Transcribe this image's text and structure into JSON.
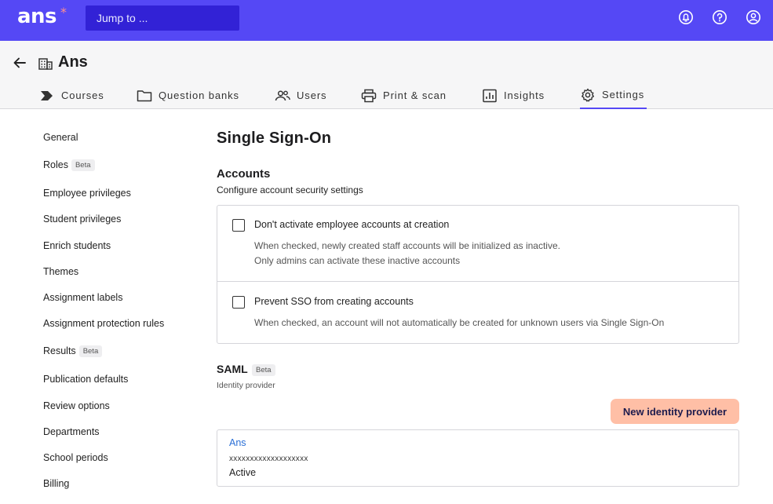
{
  "topbar": {
    "logo": "ans",
    "logo_mark": "*",
    "jump_placeholder": "Jump to ...",
    "icons": [
      "notification-icon",
      "help-icon",
      "account-icon"
    ]
  },
  "header": {
    "org_name": "Ans",
    "tabs": [
      {
        "label": "Courses",
        "icon": "courses-icon"
      },
      {
        "label": "Question banks",
        "icon": "folder-icon"
      },
      {
        "label": "Users",
        "icon": "users-icon"
      },
      {
        "label": "Print & scan",
        "icon": "printer-icon"
      },
      {
        "label": "Insights",
        "icon": "chart-icon"
      },
      {
        "label": "Settings",
        "icon": "gear-icon",
        "active": true
      }
    ]
  },
  "sidebar": {
    "beta_label": "Beta",
    "items": [
      {
        "label": "General"
      },
      {
        "label": "Roles",
        "beta": true
      },
      {
        "label": "Employee privileges"
      },
      {
        "label": "Student privileges"
      },
      {
        "label": "Enrich students"
      },
      {
        "label": "Themes"
      },
      {
        "label": "Assignment labels"
      },
      {
        "label": "Assignment protection rules"
      },
      {
        "label": "Results",
        "beta": true
      },
      {
        "label": "Publication defaults"
      },
      {
        "label": "Review options"
      },
      {
        "label": "Departments"
      },
      {
        "label": "School periods"
      },
      {
        "label": "Billing"
      }
    ]
  },
  "main": {
    "title": "Single Sign-On",
    "accounts": {
      "title": "Accounts",
      "subtitle": "Configure account security settings",
      "options": [
        {
          "label": "Don't activate employee accounts at creation",
          "checked": false,
          "desc_line1": "When checked, newly created staff accounts will be initialized as inactive.",
          "desc_line2": "Only admins can activate these inactive accounts"
        },
        {
          "label": "Prevent SSO from creating accounts",
          "checked": false,
          "desc_line1": "When checked, an account will not automatically be created for unknown users via Single Sign-On"
        }
      ]
    },
    "saml": {
      "title": "SAML",
      "beta": "Beta",
      "subtitle": "Identity provider",
      "new_button": "New identity provider",
      "provider": {
        "name": "Ans",
        "id": "xxxxxxxxxxxxxxxxxxx",
        "status": "Active"
      }
    }
  },
  "colors": {
    "brand": "#5548f5",
    "jump_bg": "#3222d6",
    "accent_button": "#ffbfa6",
    "link": "#2a6fd6"
  }
}
